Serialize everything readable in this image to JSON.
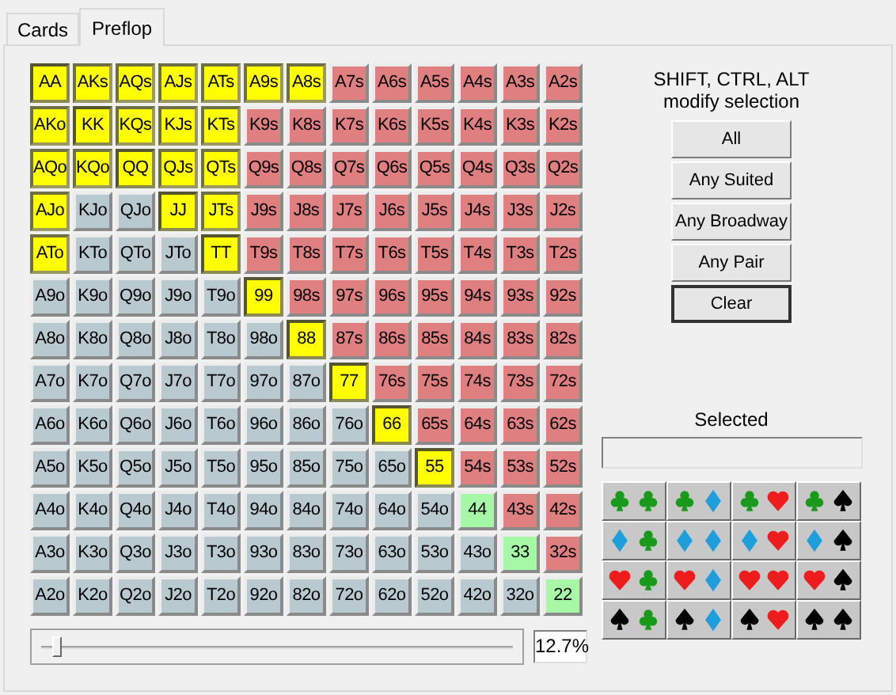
{
  "tabs": [
    {
      "label": "Cards",
      "selected": false
    },
    {
      "label": "Preflop",
      "selected": true
    }
  ],
  "grid": [
    [
      {
        "label": "AA",
        "kind": "pair",
        "selected": true
      },
      {
        "label": "AKs",
        "kind": "suited",
        "selected": true
      },
      {
        "label": "AQs",
        "kind": "suited",
        "selected": true
      },
      {
        "label": "AJs",
        "kind": "suited",
        "selected": true
      },
      {
        "label": "ATs",
        "kind": "suited",
        "selected": true
      },
      {
        "label": "A9s",
        "kind": "suited",
        "selected": true
      },
      {
        "label": "A8s",
        "kind": "suited",
        "selected": true
      },
      {
        "label": "A7s",
        "kind": "suited",
        "selected": false
      },
      {
        "label": "A6s",
        "kind": "suited",
        "selected": false
      },
      {
        "label": "A5s",
        "kind": "suited",
        "selected": false
      },
      {
        "label": "A4s",
        "kind": "suited",
        "selected": false
      },
      {
        "label": "A3s",
        "kind": "suited",
        "selected": false
      },
      {
        "label": "A2s",
        "kind": "suited",
        "selected": false
      }
    ],
    [
      {
        "label": "AKo",
        "kind": "offsuit",
        "selected": true
      },
      {
        "label": "KK",
        "kind": "pair",
        "selected": true
      },
      {
        "label": "KQs",
        "kind": "suited",
        "selected": true
      },
      {
        "label": "KJs",
        "kind": "suited",
        "selected": true
      },
      {
        "label": "KTs",
        "kind": "suited",
        "selected": true
      },
      {
        "label": "K9s",
        "kind": "suited",
        "selected": false
      },
      {
        "label": "K8s",
        "kind": "suited",
        "selected": false
      },
      {
        "label": "K7s",
        "kind": "suited",
        "selected": false
      },
      {
        "label": "K6s",
        "kind": "suited",
        "selected": false
      },
      {
        "label": "K5s",
        "kind": "suited",
        "selected": false
      },
      {
        "label": "K4s",
        "kind": "suited",
        "selected": false
      },
      {
        "label": "K3s",
        "kind": "suited",
        "selected": false
      },
      {
        "label": "K2s",
        "kind": "suited",
        "selected": false
      }
    ],
    [
      {
        "label": "AQo",
        "kind": "offsuit",
        "selected": true
      },
      {
        "label": "KQo",
        "kind": "offsuit",
        "selected": true
      },
      {
        "label": "QQ",
        "kind": "pair",
        "selected": true
      },
      {
        "label": "QJs",
        "kind": "suited",
        "selected": true
      },
      {
        "label": "QTs",
        "kind": "suited",
        "selected": true
      },
      {
        "label": "Q9s",
        "kind": "suited",
        "selected": false
      },
      {
        "label": "Q8s",
        "kind": "suited",
        "selected": false
      },
      {
        "label": "Q7s",
        "kind": "suited",
        "selected": false
      },
      {
        "label": "Q6s",
        "kind": "suited",
        "selected": false
      },
      {
        "label": "Q5s",
        "kind": "suited",
        "selected": false
      },
      {
        "label": "Q4s",
        "kind": "suited",
        "selected": false
      },
      {
        "label": "Q3s",
        "kind": "suited",
        "selected": false
      },
      {
        "label": "Q2s",
        "kind": "suited",
        "selected": false
      }
    ],
    [
      {
        "label": "AJo",
        "kind": "offsuit",
        "selected": true
      },
      {
        "label": "KJo",
        "kind": "offsuit",
        "selected": false
      },
      {
        "label": "QJo",
        "kind": "offsuit",
        "selected": false
      },
      {
        "label": "JJ",
        "kind": "pair",
        "selected": true
      },
      {
        "label": "JTs",
        "kind": "suited",
        "selected": true
      },
      {
        "label": "J9s",
        "kind": "suited",
        "selected": false
      },
      {
        "label": "J8s",
        "kind": "suited",
        "selected": false
      },
      {
        "label": "J7s",
        "kind": "suited",
        "selected": false
      },
      {
        "label": "J6s",
        "kind": "suited",
        "selected": false
      },
      {
        "label": "J5s",
        "kind": "suited",
        "selected": false
      },
      {
        "label": "J4s",
        "kind": "suited",
        "selected": false
      },
      {
        "label": "J3s",
        "kind": "suited",
        "selected": false
      },
      {
        "label": "J2s",
        "kind": "suited",
        "selected": false
      }
    ],
    [
      {
        "label": "ATo",
        "kind": "offsuit",
        "selected": true
      },
      {
        "label": "KTo",
        "kind": "offsuit",
        "selected": false
      },
      {
        "label": "QTo",
        "kind": "offsuit",
        "selected": false
      },
      {
        "label": "JTo",
        "kind": "offsuit",
        "selected": false
      },
      {
        "label": "TT",
        "kind": "pair",
        "selected": true
      },
      {
        "label": "T9s",
        "kind": "suited",
        "selected": false
      },
      {
        "label": "T8s",
        "kind": "suited",
        "selected": false
      },
      {
        "label": "T7s",
        "kind": "suited",
        "selected": false
      },
      {
        "label": "T6s",
        "kind": "suited",
        "selected": false
      },
      {
        "label": "T5s",
        "kind": "suited",
        "selected": false
      },
      {
        "label": "T4s",
        "kind": "suited",
        "selected": false
      },
      {
        "label": "T3s",
        "kind": "suited",
        "selected": false
      },
      {
        "label": "T2s",
        "kind": "suited",
        "selected": false
      }
    ],
    [
      {
        "label": "A9o",
        "kind": "offsuit",
        "selected": false
      },
      {
        "label": "K9o",
        "kind": "offsuit",
        "selected": false
      },
      {
        "label": "Q9o",
        "kind": "offsuit",
        "selected": false
      },
      {
        "label": "J9o",
        "kind": "offsuit",
        "selected": false
      },
      {
        "label": "T9o",
        "kind": "offsuit",
        "selected": false
      },
      {
        "label": "99",
        "kind": "pair",
        "selected": true
      },
      {
        "label": "98s",
        "kind": "suited",
        "selected": false
      },
      {
        "label": "97s",
        "kind": "suited",
        "selected": false
      },
      {
        "label": "96s",
        "kind": "suited",
        "selected": false
      },
      {
        "label": "95s",
        "kind": "suited",
        "selected": false
      },
      {
        "label": "94s",
        "kind": "suited",
        "selected": false
      },
      {
        "label": "93s",
        "kind": "suited",
        "selected": false
      },
      {
        "label": "92s",
        "kind": "suited",
        "selected": false
      }
    ],
    [
      {
        "label": "A8o",
        "kind": "offsuit",
        "selected": false
      },
      {
        "label": "K8o",
        "kind": "offsuit",
        "selected": false
      },
      {
        "label": "Q8o",
        "kind": "offsuit",
        "selected": false
      },
      {
        "label": "J8o",
        "kind": "offsuit",
        "selected": false
      },
      {
        "label": "T8o",
        "kind": "offsuit",
        "selected": false
      },
      {
        "label": "98o",
        "kind": "offsuit",
        "selected": false
      },
      {
        "label": "88",
        "kind": "pair",
        "selected": true
      },
      {
        "label": "87s",
        "kind": "suited",
        "selected": false
      },
      {
        "label": "86s",
        "kind": "suited",
        "selected": false
      },
      {
        "label": "85s",
        "kind": "suited",
        "selected": false
      },
      {
        "label": "84s",
        "kind": "suited",
        "selected": false
      },
      {
        "label": "83s",
        "kind": "suited",
        "selected": false
      },
      {
        "label": "82s",
        "kind": "suited",
        "selected": false
      }
    ],
    [
      {
        "label": "A7o",
        "kind": "offsuit",
        "selected": false
      },
      {
        "label": "K7o",
        "kind": "offsuit",
        "selected": false
      },
      {
        "label": "Q7o",
        "kind": "offsuit",
        "selected": false
      },
      {
        "label": "J7o",
        "kind": "offsuit",
        "selected": false
      },
      {
        "label": "T7o",
        "kind": "offsuit",
        "selected": false
      },
      {
        "label": "97o",
        "kind": "offsuit",
        "selected": false
      },
      {
        "label": "87o",
        "kind": "offsuit",
        "selected": false
      },
      {
        "label": "77",
        "kind": "pair",
        "selected": true
      },
      {
        "label": "76s",
        "kind": "suited",
        "selected": false
      },
      {
        "label": "75s",
        "kind": "suited",
        "selected": false
      },
      {
        "label": "74s",
        "kind": "suited",
        "selected": false
      },
      {
        "label": "73s",
        "kind": "suited",
        "selected": false
      },
      {
        "label": "72s",
        "kind": "suited",
        "selected": false
      }
    ],
    [
      {
        "label": "A6o",
        "kind": "offsuit",
        "selected": false
      },
      {
        "label": "K6o",
        "kind": "offsuit",
        "selected": false
      },
      {
        "label": "Q6o",
        "kind": "offsuit",
        "selected": false
      },
      {
        "label": "J6o",
        "kind": "offsuit",
        "selected": false
      },
      {
        "label": "T6o",
        "kind": "offsuit",
        "selected": false
      },
      {
        "label": "96o",
        "kind": "offsuit",
        "selected": false
      },
      {
        "label": "86o",
        "kind": "offsuit",
        "selected": false
      },
      {
        "label": "76o",
        "kind": "offsuit",
        "selected": false
      },
      {
        "label": "66",
        "kind": "pair",
        "selected": true
      },
      {
        "label": "65s",
        "kind": "suited",
        "selected": false
      },
      {
        "label": "64s",
        "kind": "suited",
        "selected": false
      },
      {
        "label": "63s",
        "kind": "suited",
        "selected": false
      },
      {
        "label": "62s",
        "kind": "suited",
        "selected": false
      }
    ],
    [
      {
        "label": "A5o",
        "kind": "offsuit",
        "selected": false
      },
      {
        "label": "K5o",
        "kind": "offsuit",
        "selected": false
      },
      {
        "label": "Q5o",
        "kind": "offsuit",
        "selected": false
      },
      {
        "label": "J5o",
        "kind": "offsuit",
        "selected": false
      },
      {
        "label": "T5o",
        "kind": "offsuit",
        "selected": false
      },
      {
        "label": "95o",
        "kind": "offsuit",
        "selected": false
      },
      {
        "label": "85o",
        "kind": "offsuit",
        "selected": false
      },
      {
        "label": "75o",
        "kind": "offsuit",
        "selected": false
      },
      {
        "label": "65o",
        "kind": "offsuit",
        "selected": false
      },
      {
        "label": "55",
        "kind": "pair",
        "selected": true
      },
      {
        "label": "54s",
        "kind": "suited",
        "selected": false
      },
      {
        "label": "53s",
        "kind": "suited",
        "selected": false
      },
      {
        "label": "52s",
        "kind": "suited",
        "selected": false
      }
    ],
    [
      {
        "label": "A4o",
        "kind": "offsuit",
        "selected": false
      },
      {
        "label": "K4o",
        "kind": "offsuit",
        "selected": false
      },
      {
        "label": "Q4o",
        "kind": "offsuit",
        "selected": false
      },
      {
        "label": "J4o",
        "kind": "offsuit",
        "selected": false
      },
      {
        "label": "T4o",
        "kind": "offsuit",
        "selected": false
      },
      {
        "label": "94o",
        "kind": "offsuit",
        "selected": false
      },
      {
        "label": "84o",
        "kind": "offsuit",
        "selected": false
      },
      {
        "label": "74o",
        "kind": "offsuit",
        "selected": false
      },
      {
        "label": "64o",
        "kind": "offsuit",
        "selected": false
      },
      {
        "label": "54o",
        "kind": "offsuit",
        "selected": false
      },
      {
        "label": "44",
        "kind": "pair",
        "selected": false
      },
      {
        "label": "43s",
        "kind": "suited",
        "selected": false
      },
      {
        "label": "42s",
        "kind": "suited",
        "selected": false
      }
    ],
    [
      {
        "label": "A3o",
        "kind": "offsuit",
        "selected": false
      },
      {
        "label": "K3o",
        "kind": "offsuit",
        "selected": false
      },
      {
        "label": "Q3o",
        "kind": "offsuit",
        "selected": false
      },
      {
        "label": "J3o",
        "kind": "offsuit",
        "selected": false
      },
      {
        "label": "T3o",
        "kind": "offsuit",
        "selected": false
      },
      {
        "label": "93o",
        "kind": "offsuit",
        "selected": false
      },
      {
        "label": "83o",
        "kind": "offsuit",
        "selected": false
      },
      {
        "label": "73o",
        "kind": "offsuit",
        "selected": false
      },
      {
        "label": "63o",
        "kind": "offsuit",
        "selected": false
      },
      {
        "label": "53o",
        "kind": "offsuit",
        "selected": false
      },
      {
        "label": "43o",
        "kind": "offsuit",
        "selected": false
      },
      {
        "label": "33",
        "kind": "pair",
        "selected": false
      },
      {
        "label": "32s",
        "kind": "suited",
        "selected": false
      }
    ],
    [
      {
        "label": "A2o",
        "kind": "offsuit",
        "selected": false
      },
      {
        "label": "K2o",
        "kind": "offsuit",
        "selected": false
      },
      {
        "label": "Q2o",
        "kind": "offsuit",
        "selected": false
      },
      {
        "label": "J2o",
        "kind": "offsuit",
        "selected": false
      },
      {
        "label": "T2o",
        "kind": "offsuit",
        "selected": false
      },
      {
        "label": "92o",
        "kind": "offsuit",
        "selected": false
      },
      {
        "label": "82o",
        "kind": "offsuit",
        "selected": false
      },
      {
        "label": "72o",
        "kind": "offsuit",
        "selected": false
      },
      {
        "label": "62o",
        "kind": "offsuit",
        "selected": false
      },
      {
        "label": "52o",
        "kind": "offsuit",
        "selected": false
      },
      {
        "label": "42o",
        "kind": "offsuit",
        "selected": false
      },
      {
        "label": "32o",
        "kind": "offsuit",
        "selected": false
      },
      {
        "label": "22",
        "kind": "pair",
        "selected": false
      }
    ]
  ],
  "hint": [
    "SHIFT, CTRL, ALT",
    "modify selection"
  ],
  "buttons": [
    {
      "label": "All",
      "focused": false
    },
    {
      "label": "Any Suited",
      "focused": false
    },
    {
      "label": "Any Broadway",
      "focused": false
    },
    {
      "label": "Any Pair",
      "focused": false
    },
    {
      "label": "Clear",
      "focused": true
    }
  ],
  "selected_label": "Selected",
  "suit_combos": [
    {
      "suits": [
        {
          "kind": "club"
        },
        {
          "kind": "club"
        }
      ]
    },
    {
      "suits": [
        {
          "kind": "club"
        },
        {
          "kind": "diamond"
        }
      ]
    },
    {
      "suits": [
        {
          "kind": "club"
        },
        {
          "kind": "heart"
        }
      ]
    },
    {
      "suits": [
        {
          "kind": "club"
        },
        {
          "kind": "spade"
        }
      ]
    },
    {
      "suits": [
        {
          "kind": "diamond"
        },
        {
          "kind": "club"
        }
      ]
    },
    {
      "suits": [
        {
          "kind": "diamond"
        },
        {
          "kind": "diamond"
        }
      ]
    },
    {
      "suits": [
        {
          "kind": "diamond"
        },
        {
          "kind": "heart"
        }
      ]
    },
    {
      "suits": [
        {
          "kind": "diamond"
        },
        {
          "kind": "spade"
        }
      ]
    },
    {
      "suits": [
        {
          "kind": "heart"
        },
        {
          "kind": "club"
        }
      ]
    },
    {
      "suits": [
        {
          "kind": "heart"
        },
        {
          "kind": "diamond"
        }
      ]
    },
    {
      "suits": [
        {
          "kind": "heart"
        },
        {
          "kind": "heart"
        }
      ]
    },
    {
      "suits": [
        {
          "kind": "heart"
        },
        {
          "kind": "spade"
        }
      ]
    },
    {
      "suits": [
        {
          "kind": "spade"
        },
        {
          "kind": "club"
        }
      ]
    },
    {
      "suits": [
        {
          "kind": "spade"
        },
        {
          "kind": "diamond"
        }
      ]
    },
    {
      "suits": [
        {
          "kind": "spade"
        },
        {
          "kind": "heart"
        }
      ]
    },
    {
      "suits": [
        {
          "kind": "spade"
        },
        {
          "kind": "spade"
        }
      ]
    }
  ],
  "slider": {
    "level": 0.02
  },
  "percent": "12.7%"
}
